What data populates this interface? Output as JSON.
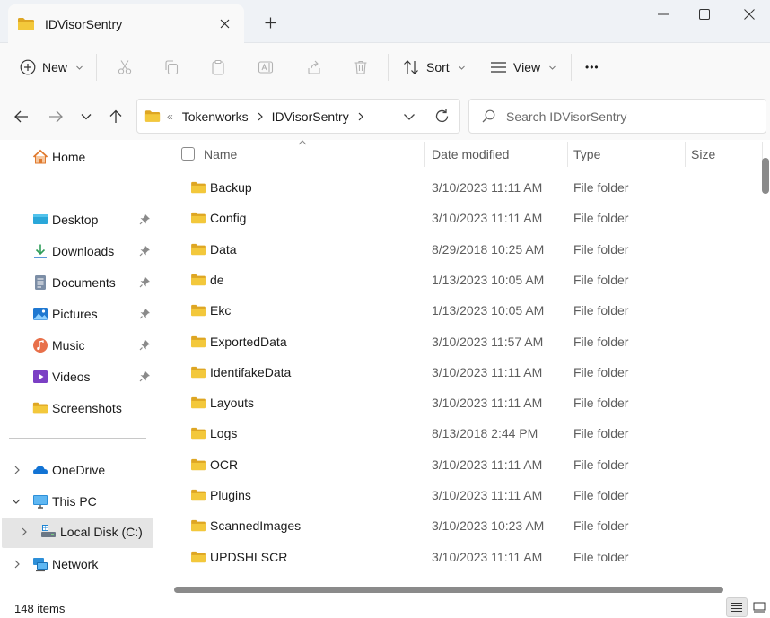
{
  "window": {
    "tab_title": "IDVisorSentry"
  },
  "toolbar": {
    "new_label": "New",
    "sort_label": "Sort",
    "view_label": "View",
    "more_label": "•••"
  },
  "address": {
    "overflow": "«",
    "breadcrumbs": [
      "Tokenworks",
      "IDVisorSentry"
    ]
  },
  "search": {
    "placeholder": "Search IDVisorSentry"
  },
  "sidebar": {
    "home": "Home",
    "quick_access": [
      {
        "label": "Desktop",
        "icon": "desktop-icon"
      },
      {
        "label": "Downloads",
        "icon": "download-icon"
      },
      {
        "label": "Documents",
        "icon": "documents-icon"
      },
      {
        "label": "Pictures",
        "icon": "pictures-icon"
      },
      {
        "label": "Music",
        "icon": "music-icon"
      },
      {
        "label": "Videos",
        "icon": "videos-icon"
      },
      {
        "label": "Screenshots",
        "icon": "folder-icon"
      }
    ],
    "tree": [
      {
        "label": "OneDrive",
        "icon": "cloud-icon"
      },
      {
        "label": "This PC",
        "icon": "computer-icon"
      },
      {
        "label": "Local Disk (C:)",
        "icon": "drive-icon"
      },
      {
        "label": "Network",
        "icon": "network-icon"
      }
    ]
  },
  "columns": {
    "name": "Name",
    "date": "Date modified",
    "type": "Type",
    "size": "Size"
  },
  "files": [
    {
      "name": "Backup",
      "date": "3/10/2023 11:11 AM",
      "type": "File folder"
    },
    {
      "name": "Config",
      "date": "3/10/2023 11:11 AM",
      "type": "File folder"
    },
    {
      "name": "Data",
      "date": "8/29/2018 10:25 AM",
      "type": "File folder"
    },
    {
      "name": "de",
      "date": "1/13/2023 10:05 AM",
      "type": "File folder"
    },
    {
      "name": "Ekc",
      "date": "1/13/2023 10:05 AM",
      "type": "File folder"
    },
    {
      "name": "ExportedData",
      "date": "3/10/2023 11:57 AM",
      "type": "File folder"
    },
    {
      "name": "IdentifakeData",
      "date": "3/10/2023 11:11 AM",
      "type": "File folder"
    },
    {
      "name": "Layouts",
      "date": "3/10/2023 11:11 AM",
      "type": "File folder"
    },
    {
      "name": "Logs",
      "date": "8/13/2018 2:44 PM",
      "type": "File folder"
    },
    {
      "name": "OCR",
      "date": "3/10/2023 11:11 AM",
      "type": "File folder"
    },
    {
      "name": "Plugins",
      "date": "3/10/2023 11:11 AM",
      "type": "File folder"
    },
    {
      "name": "ScannedImages",
      "date": "3/10/2023 10:23 AM",
      "type": "File folder"
    },
    {
      "name": "UPDSHLSCR",
      "date": "3/10/2023 11:11 AM",
      "type": "File folder"
    }
  ],
  "status": {
    "item_count": "148 items"
  },
  "colors": {
    "folder_yellow": "#f3c83b",
    "folder_dark": "#dea623",
    "accent_blue": "#0067c0",
    "selected_bg": "#e5e5e5"
  }
}
